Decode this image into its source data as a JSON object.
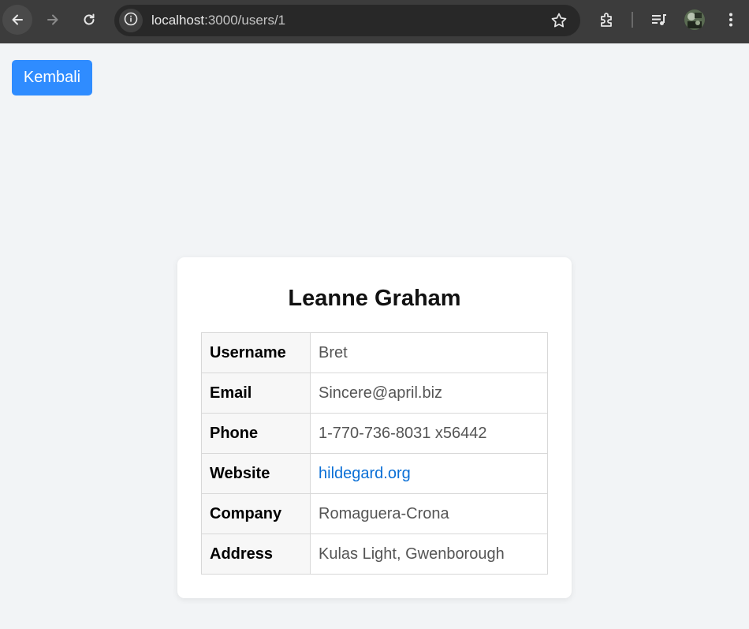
{
  "browser": {
    "url_host": "localhost",
    "url_path": ":3000/users/1",
    "icons": [
      "back-arrow-icon",
      "forward-arrow-icon",
      "reload-icon",
      "site-info-icon",
      "bookmark-star-icon",
      "extensions-icon",
      "media-control-icon",
      "profile-avatar",
      "more-menu-icon"
    ]
  },
  "page": {
    "back_label": "Kembali",
    "accent": "#2f8cff"
  },
  "user": {
    "name": "Leanne Graham",
    "rows": [
      {
        "label": "Username",
        "value": "Bret"
      },
      {
        "label": "Email",
        "value": "Sincere@april.biz"
      },
      {
        "label": "Phone",
        "value": "1-770-736-8031 x56442"
      },
      {
        "label": "Website",
        "value": "hildegard.org"
      },
      {
        "label": "Company",
        "value": "Romaguera-Crona"
      },
      {
        "label": "Address",
        "value": "Kulas Light, Gwenborough"
      }
    ]
  }
}
